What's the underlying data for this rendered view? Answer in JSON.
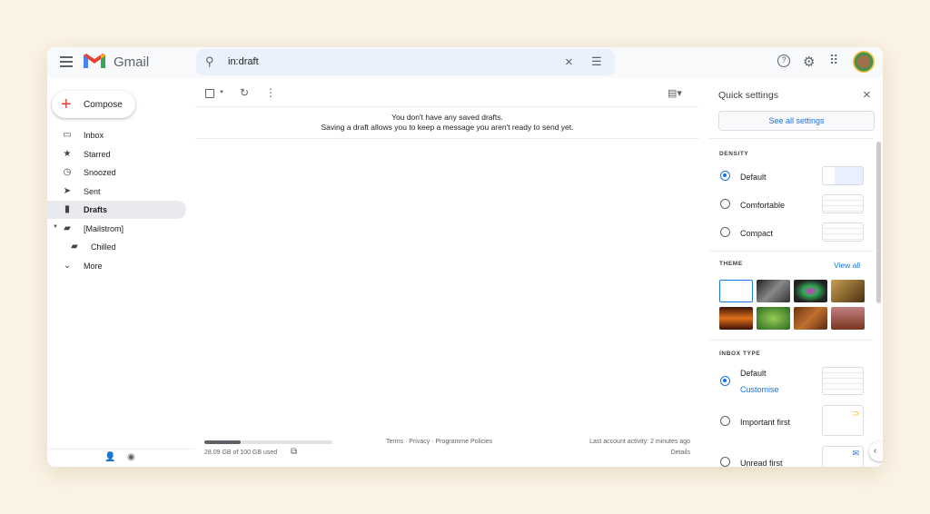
{
  "app": {
    "brand": "Gmail"
  },
  "search": {
    "value": "in:draft"
  },
  "sidebar": {
    "compose": "Compose",
    "items": [
      {
        "label": "Inbox",
        "icon": "inbox-icon",
        "glyph": "▭"
      },
      {
        "label": "Starred",
        "icon": "star-icon",
        "glyph": "★"
      },
      {
        "label": "Snoozed",
        "icon": "clock-icon",
        "glyph": "◷"
      },
      {
        "label": "Sent",
        "icon": "send-icon",
        "glyph": "➤"
      },
      {
        "label": "Drafts",
        "icon": "draft-icon",
        "glyph": "▮"
      },
      {
        "label": "[Mailstrom]",
        "icon": "label-icon",
        "glyph": "▰"
      },
      {
        "label": "Chilled",
        "icon": "label-icon",
        "glyph": "▰"
      },
      {
        "label": "More",
        "icon": "chevron-down-icon",
        "glyph": "⌄"
      }
    ],
    "active": "Drafts"
  },
  "main": {
    "empty_title": "You don't have any saved drafts.",
    "empty_sub": "Saving a draft allows you to keep a message you aren't ready to send yet."
  },
  "footer": {
    "storage": "28.09 GB of 100 GB used",
    "storage_fraction": 0.2809,
    "links": "Terms · Privacy · Programme Policies",
    "activity": "Last account activity: 2 minutes ago",
    "details": "Details"
  },
  "quick_settings": {
    "title": "Quick settings",
    "see_all": "See all settings",
    "density": {
      "heading": "DENSITY",
      "options": [
        "Default",
        "Comfortable",
        "Compact"
      ],
      "selected": "Default"
    },
    "theme": {
      "heading": "THEME",
      "view_all": "View all"
    },
    "inbox_type": {
      "heading": "INBOX TYPE",
      "options": [
        "Default",
        "Important first",
        "Unread first"
      ],
      "selected": "Default",
      "customise": "Customise"
    }
  },
  "colors": {
    "accent": "#1a73e8",
    "active_nav": "#e8eaed",
    "search_bg": "#eaf1fb"
  }
}
